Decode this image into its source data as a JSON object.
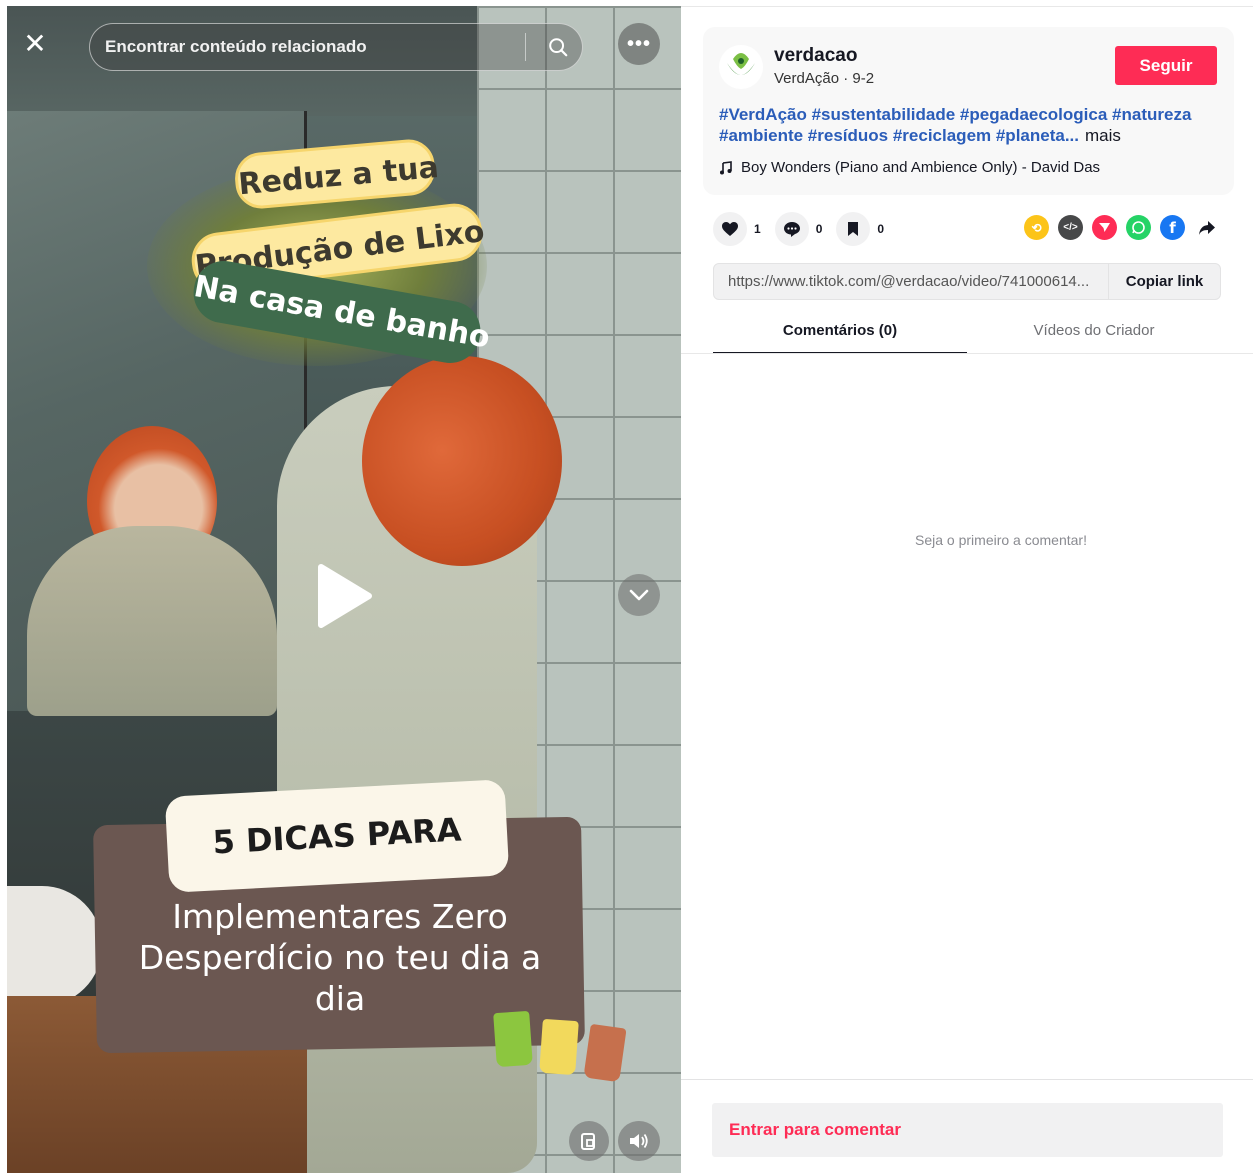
{
  "video": {
    "search": {
      "placeholder": "Encontrar conteúdo relacionado"
    },
    "overlay": {
      "tag_line1": "Reduz a tua",
      "tag_line2": "Produção de Lixo",
      "tag_line3": "Na casa de banho",
      "card_title": "5 DICAS PARA",
      "card_text": "Implementares Zero Desperdício no teu dia a dia"
    },
    "bins_colors": [
      "#8cc63f",
      "#f2d95c",
      "#c6704d"
    ]
  },
  "post": {
    "username": "verdacao",
    "display_name": "VerdAção",
    "date": "9-2",
    "subline": "VerdAção · 9-2",
    "follow_label": "Seguir",
    "hashtags": "#VerdAção #sustentabilidade #pegadaecologica #natureza #ambiente #resíduos #reciclagem #planeta...",
    "more_label": "mais",
    "music": "Boy Wonders (Piano and Ambience Only) - David Das"
  },
  "actions": {
    "likes": "1",
    "comments": "0",
    "saves": "0"
  },
  "share_icons": [
    "repost-icon",
    "embed-icon",
    "send-icon",
    "whatsapp-icon",
    "facebook-icon",
    "share-arrow-icon"
  ],
  "link": {
    "url": "https://www.tiktok.com/@verdacao/video/741000614...",
    "copy_label": "Copiar link"
  },
  "tabs": [
    {
      "label": "Comentários (0)",
      "active": true
    },
    {
      "label": "Vídeos do Criador",
      "active": false
    }
  ],
  "comments": {
    "empty_text": "Seja o primeiro a comentar!"
  },
  "login_label": "Entrar para comentar",
  "colors": {
    "accent": "#fe2c55",
    "hashtag": "#2b5db9"
  }
}
